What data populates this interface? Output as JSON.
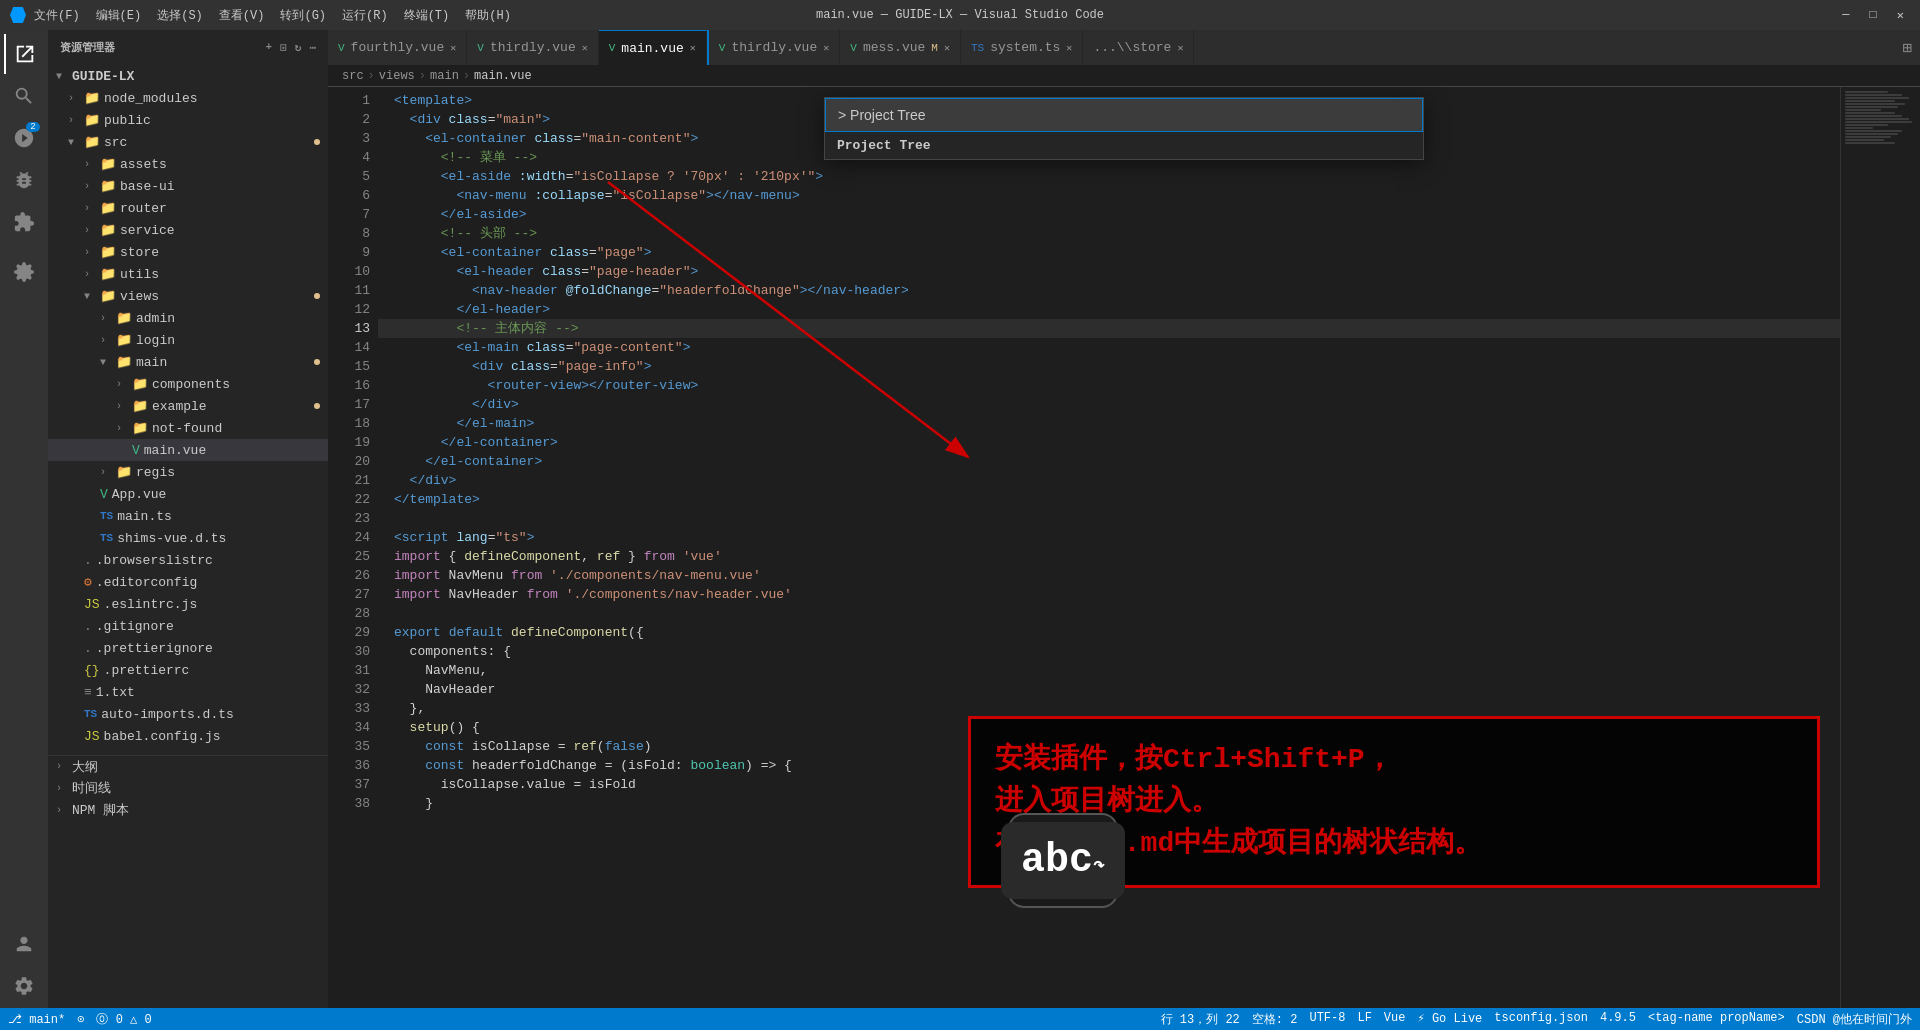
{
  "titlebar": {
    "menu_items": [
      "文件(F)",
      "编辑(E)",
      "选择(S)",
      "查看(V)",
      "转到(G)",
      "运行(R)",
      "终端(T)",
      "帮助(H)"
    ],
    "title": "main.vue — GUIDE-LX — Visual Studio Code",
    "controls": [
      "─",
      "□",
      "✕"
    ]
  },
  "activity_bar": {
    "icons": [
      {
        "name": "explorer-icon",
        "symbol": "⬜",
        "active": true
      },
      {
        "name": "search-icon",
        "symbol": "🔍",
        "active": false
      },
      {
        "name": "git-icon",
        "symbol": "⑂",
        "active": false,
        "badge": "2"
      },
      {
        "name": "debug-icon",
        "symbol": "▷",
        "active": false
      },
      {
        "name": "extensions-icon",
        "symbol": "⊞",
        "active": false
      },
      {
        "name": "remote-icon",
        "symbol": "⊗",
        "active": false
      }
    ],
    "bottom_icons": [
      {
        "name": "account-icon",
        "symbol": "👤"
      },
      {
        "name": "settings-icon",
        "symbol": "⚙"
      }
    ]
  },
  "sidebar": {
    "title": "资源管理器",
    "root": "GUIDE-LX",
    "tree": [
      {
        "label": "node_modules",
        "indent": 1,
        "type": "folder",
        "collapsed": true
      },
      {
        "label": "public",
        "indent": 1,
        "type": "folder",
        "collapsed": true
      },
      {
        "label": "src",
        "indent": 1,
        "type": "folder",
        "collapsed": false,
        "dot": true
      },
      {
        "label": "assets",
        "indent": 2,
        "type": "folder",
        "collapsed": true
      },
      {
        "label": "base-ui",
        "indent": 2,
        "type": "folder",
        "collapsed": true
      },
      {
        "label": "router",
        "indent": 2,
        "type": "folder",
        "collapsed": true
      },
      {
        "label": "service",
        "indent": 2,
        "type": "folder",
        "collapsed": true
      },
      {
        "label": "store",
        "indent": 2,
        "type": "folder",
        "collapsed": true
      },
      {
        "label": "utils",
        "indent": 2,
        "type": "folder",
        "collapsed": true
      },
      {
        "label": "views",
        "indent": 2,
        "type": "folder",
        "collapsed": false,
        "dot": true
      },
      {
        "label": "admin",
        "indent": 3,
        "type": "folder",
        "collapsed": true
      },
      {
        "label": "login",
        "indent": 3,
        "type": "folder",
        "collapsed": true
      },
      {
        "label": "main",
        "indent": 3,
        "type": "folder",
        "collapsed": false,
        "dot": true
      },
      {
        "label": "components",
        "indent": 4,
        "type": "folder",
        "collapsed": true
      },
      {
        "label": "example",
        "indent": 4,
        "type": "folder",
        "collapsed": true,
        "dot": true
      },
      {
        "label": "not-found",
        "indent": 4,
        "type": "folder",
        "collapsed": true
      },
      {
        "label": "main.vue",
        "indent": 4,
        "type": "vue",
        "active": true
      },
      {
        "label": "regis",
        "indent": 3,
        "type": "folder",
        "collapsed": true
      },
      {
        "label": "App.vue",
        "indent": 2,
        "type": "vue"
      },
      {
        "label": "main.ts",
        "indent": 2,
        "type": "ts"
      },
      {
        "label": "shims-vue.d.ts",
        "indent": 2,
        "type": "ts"
      },
      {
        "label": ".browserslistrc",
        "indent": 1,
        "type": "file"
      },
      {
        "label": ".editorconfig",
        "indent": 1,
        "type": "file"
      },
      {
        "label": ".eslintrc.js",
        "indent": 1,
        "type": "js"
      },
      {
        "label": ".gitignore",
        "indent": 1,
        "type": "file"
      },
      {
        "label": ".prettierignore",
        "indent": 1,
        "type": "file"
      },
      {
        "label": ".prettierrc",
        "indent": 1,
        "type": "json"
      },
      {
        "label": "1.txt",
        "indent": 1,
        "type": "file"
      },
      {
        "label": "auto-imports.d.ts",
        "indent": 1,
        "type": "ts"
      },
      {
        "label": "babel.config.js",
        "indent": 1,
        "type": "js"
      }
    ],
    "folders": [
      "大纲",
      "时间线",
      "NPM 脚本"
    ]
  },
  "tabs": [
    {
      "label": "fourthly.vue",
      "icon": "vue",
      "active": false,
      "modified": false
    },
    {
      "label": "thirdly.vue",
      "icon": "vue",
      "active": false,
      "modified": false
    },
    {
      "label": "main.vue",
      "icon": "vue",
      "active": true,
      "modified": false
    },
    {
      "label": "thirdly.vue",
      "icon": "vue",
      "active": false,
      "modified": false
    },
    {
      "label": "mess.vue",
      "icon": "vue",
      "active": false,
      "modified": true,
      "label_suffix": "M"
    },
    {
      "label": "system.ts",
      "icon": "ts",
      "active": false,
      "modified": false
    },
    {
      "label": "...\\store",
      "icon": "",
      "active": false
    }
  ],
  "breadcrumb": {
    "parts": [
      "src",
      ">",
      "views",
      ">",
      "main",
      ">",
      "main.vue"
    ]
  },
  "command_palette": {
    "input_value": "> Project Tree",
    "result": "Project Tree"
  },
  "code": {
    "lines": [
      {
        "n": 1,
        "text": "<template>",
        "tokens": [
          {
            "t": "t-tag",
            "v": "<template>"
          }
        ]
      },
      {
        "n": 2,
        "text": "  <div class=\"main\">",
        "tokens": [
          {
            "t": "t-tag",
            "v": "  <div"
          },
          {
            "t": "t-attr",
            "v": " class"
          },
          {
            "t": "t-white",
            "v": "="
          },
          {
            "t": "t-val",
            "v": "\"main\""
          },
          {
            "t": "t-tag",
            "v": ">"
          }
        ]
      },
      {
        "n": 3,
        "text": "    <el-container class=\"main-content\">",
        "tokens": [
          {
            "t": "t-tag",
            "v": "    <el-container"
          },
          {
            "t": "t-attr",
            "v": " class"
          },
          {
            "t": "t-white",
            "v": "="
          },
          {
            "t": "t-val",
            "v": "\"main-content\""
          },
          {
            "t": "t-tag",
            "v": ">"
          }
        ]
      },
      {
        "n": 4,
        "text": "      <!-- 菜单 -->",
        "tokens": [
          {
            "t": "t-comment",
            "v": "      <!-- 菜单 -->"
          }
        ]
      },
      {
        "n": 5,
        "text": "      <el-aside :width=\"isCollapse ? '70px' : '210px'\">",
        "tokens": [
          {
            "t": "t-tag",
            "v": "      <el-aside"
          },
          {
            "t": "t-attr",
            "v": " :width"
          },
          {
            "t": "t-white",
            "v": "="
          },
          {
            "t": "t-val",
            "v": "\"isCollapse ? '70px' : '210px'\""
          },
          {
            "t": "t-tag",
            "v": ">"
          }
        ]
      },
      {
        "n": 6,
        "text": "        <nav-menu :collapse=\"isCollapse\"></nav-menu>",
        "tokens": [
          {
            "t": "t-tag",
            "v": "        <nav-menu"
          },
          {
            "t": "t-attr",
            "v": " :collapse"
          },
          {
            "t": "t-white",
            "v": "="
          },
          {
            "t": "t-val",
            "v": "\"isCollapse\""
          },
          {
            "t": "t-tag",
            "v": "></nav-menu>"
          }
        ]
      },
      {
        "n": 7,
        "text": "      </el-aside>",
        "tokens": [
          {
            "t": "t-tag",
            "v": "      </el-aside>"
          }
        ]
      },
      {
        "n": 8,
        "text": "      <!-- 头部 -->",
        "tokens": [
          {
            "t": "t-comment",
            "v": "      <!-- 头部 -->"
          }
        ]
      },
      {
        "n": 9,
        "text": "      <el-container class=\"page\">",
        "tokens": [
          {
            "t": "t-tag",
            "v": "      <el-container"
          },
          {
            "t": "t-attr",
            "v": " class"
          },
          {
            "t": "t-white",
            "v": "="
          },
          {
            "t": "t-val",
            "v": "\"page\""
          },
          {
            "t": "t-tag",
            "v": ">"
          }
        ]
      },
      {
        "n": 10,
        "text": "        <el-header class=\"page-header\">",
        "tokens": [
          {
            "t": "t-tag",
            "v": "        <el-header"
          },
          {
            "t": "t-attr",
            "v": " class"
          },
          {
            "t": "t-white",
            "v": "="
          },
          {
            "t": "t-val",
            "v": "\"page-header\""
          },
          {
            "t": "t-tag",
            "v": ">"
          }
        ]
      },
      {
        "n": 11,
        "text": "          <nav-header @foldChange=\"headerfoldChange\"></nav-header>",
        "tokens": [
          {
            "t": "t-tag",
            "v": "          <nav-header"
          },
          {
            "t": "t-attr",
            "v": " @foldChange"
          },
          {
            "t": "t-white",
            "v": "="
          },
          {
            "t": "t-val",
            "v": "\"headerfoldChange\""
          },
          {
            "t": "t-tag",
            "v": "></nav-header>"
          }
        ]
      },
      {
        "n": 12,
        "text": "        </el-header>",
        "tokens": [
          {
            "t": "t-tag",
            "v": "        </el-header>"
          }
        ]
      },
      {
        "n": 13,
        "text": "        <!-- 主体内容 -->",
        "tokens": [
          {
            "t": "t-comment",
            "v": "        <!-- 主体内容 -->"
          }
        ]
      },
      {
        "n": 14,
        "text": "        <el-main class=\"page-content\">",
        "tokens": [
          {
            "t": "t-tag",
            "v": "        <el-main"
          },
          {
            "t": "t-attr",
            "v": " class"
          },
          {
            "t": "t-white",
            "v": "="
          },
          {
            "t": "t-val",
            "v": "\"page-content\""
          },
          {
            "t": "t-tag",
            "v": ">"
          }
        ]
      },
      {
        "n": 15,
        "text": "          <div class=\"page-info\">",
        "tokens": [
          {
            "t": "t-tag",
            "v": "          <div"
          },
          {
            "t": "t-attr",
            "v": " class"
          },
          {
            "t": "t-white",
            "v": "="
          },
          {
            "t": "t-val",
            "v": "\"page-info\""
          },
          {
            "t": "t-tag",
            "v": ">"
          }
        ]
      },
      {
        "n": 16,
        "text": "            <router-view></router-view>",
        "tokens": [
          {
            "t": "t-tag",
            "v": "            <router-view></router-view>"
          }
        ]
      },
      {
        "n": 17,
        "text": "          </div>",
        "tokens": [
          {
            "t": "t-tag",
            "v": "          </div>"
          }
        ]
      },
      {
        "n": 18,
        "text": "        </el-main>",
        "tokens": [
          {
            "t": "t-tag",
            "v": "        </el-main>"
          }
        ]
      },
      {
        "n": 19,
        "text": "      </el-container>",
        "tokens": [
          {
            "t": "t-tag",
            "v": "      </el-container>"
          }
        ]
      },
      {
        "n": 20,
        "text": "    </el-container>",
        "tokens": [
          {
            "t": "t-tag",
            "v": "    </el-container>"
          }
        ]
      },
      {
        "n": 21,
        "text": "  </div>",
        "tokens": [
          {
            "t": "t-tag",
            "v": "  </div>"
          }
        ]
      },
      {
        "n": 22,
        "text": "</template>",
        "tokens": [
          {
            "t": "t-tag",
            "v": "</template>"
          }
        ]
      },
      {
        "n": 23,
        "text": "",
        "tokens": []
      },
      {
        "n": 24,
        "text": "<script lang=\"ts\">",
        "tokens": [
          {
            "t": "t-tag",
            "v": "<script"
          },
          {
            "t": "t-attr",
            "v": " lang"
          },
          {
            "t": "t-white",
            "v": "="
          },
          {
            "t": "t-val",
            "v": "\"ts\""
          },
          {
            "t": "t-tag",
            "v": ">"
          }
        ]
      },
      {
        "n": 25,
        "text": "import { defineComponent, ref } from 'vue'",
        "tokens": [
          {
            "t": "t-import",
            "v": "import"
          },
          {
            "t": "t-white",
            "v": " { "
          },
          {
            "t": "t-fn",
            "v": "defineComponent"
          },
          {
            "t": "t-white",
            "v": ", "
          },
          {
            "t": "t-fn",
            "v": "ref"
          },
          {
            "t": "t-white",
            "v": " } "
          },
          {
            "t": "t-import",
            "v": "from"
          },
          {
            "t": "t-string",
            "v": " 'vue'"
          }
        ]
      },
      {
        "n": 26,
        "text": "import NavMenu from './components/nav-menu.vue'",
        "tokens": [
          {
            "t": "t-import",
            "v": "import"
          },
          {
            "t": "t-white",
            "v": " NavMenu "
          },
          {
            "t": "t-import",
            "v": "from"
          },
          {
            "t": "t-string",
            "v": " './components/nav-menu.vue'"
          }
        ]
      },
      {
        "n": 27,
        "text": "import NavHeader from './components/nav-header.vue'",
        "tokens": [
          {
            "t": "t-import",
            "v": "import"
          },
          {
            "t": "t-white",
            "v": " NavHeader "
          },
          {
            "t": "t-import",
            "v": "from"
          },
          {
            "t": "t-string",
            "v": " './components/nav-header.vue'"
          }
        ]
      },
      {
        "n": 28,
        "text": "",
        "tokens": []
      },
      {
        "n": 29,
        "text": "export default defineComponent({",
        "tokens": [
          {
            "t": "t-kw",
            "v": "export"
          },
          {
            "t": "t-white",
            "v": " "
          },
          {
            "t": "t-kw",
            "v": "default"
          },
          {
            "t": "t-white",
            "v": " "
          },
          {
            "t": "t-fn",
            "v": "defineComponent"
          },
          {
            "t": "t-white",
            "v": "({"
          }
        ]
      },
      {
        "n": 30,
        "text": "  components: {",
        "tokens": [
          {
            "t": "t-white",
            "v": "  components: {"
          }
        ]
      },
      {
        "n": 31,
        "text": "    NavMenu,",
        "tokens": [
          {
            "t": "t-white",
            "v": "    NavMenu,"
          }
        ]
      },
      {
        "n": 32,
        "text": "    NavHeader",
        "tokens": [
          {
            "t": "t-white",
            "v": "    NavHeader"
          }
        ]
      },
      {
        "n": 33,
        "text": "  },",
        "tokens": [
          {
            "t": "t-white",
            "v": "  },"
          }
        ]
      },
      {
        "n": 34,
        "text": "  setup() {",
        "tokens": [
          {
            "t": "t-white",
            "v": "  "
          },
          {
            "t": "t-fn",
            "v": "setup"
          },
          {
            "t": "t-white",
            "v": "() {"
          }
        ]
      },
      {
        "n": 35,
        "text": "    const isCollapse = ref(false)",
        "tokens": [
          {
            "t": "t-white",
            "v": "    "
          },
          {
            "t": "t-kw",
            "v": "const"
          },
          {
            "t": "t-white",
            "v": " isCollapse = "
          },
          {
            "t": "t-fn",
            "v": "ref"
          },
          {
            "t": "t-white",
            "v": "("
          },
          {
            "t": "t-kw",
            "v": "false"
          },
          {
            "t": "t-white",
            "v": ")"
          }
        ]
      },
      {
        "n": 36,
        "text": "    const headerfoldChange = (isFold: boolean) => {",
        "tokens": [
          {
            "t": "t-white",
            "v": "    "
          },
          {
            "t": "t-kw",
            "v": "const"
          },
          {
            "t": "t-white",
            "v": " headerfoldChange = (isFold: "
          },
          {
            "t": "t-type",
            "v": "boolean"
          },
          {
            "t": "t-white",
            "v": ") => {"
          }
        ]
      },
      {
        "n": 37,
        "text": "      isCollapse.value = isFold",
        "tokens": [
          {
            "t": "t-white",
            "v": "      isCollapse.value = isFold"
          }
        ]
      },
      {
        "n": 38,
        "text": "    }",
        "tokens": [
          {
            "t": "t-white",
            "v": "    }"
          }
        ]
      }
    ]
  },
  "annotation": {
    "red_box_text": "安装插件，按Ctrl+Shift+P，\n进入项目树进入。\n在README.md中生成项目的树状结构。",
    "abc_text": "abc"
  },
  "statusbar": {
    "left": [
      "⎇ main*",
      "⊙",
      "⓪ 0 △ 0"
    ],
    "right": [
      "行 13，列 22",
      "空格: 2",
      "UTF-8",
      "LF",
      "Vue",
      "⚡ Go Live",
      "tsconfig.json",
      "4.9.5",
      "<tag-name propName>",
      "CSDN @他在时间门外"
    ]
  }
}
